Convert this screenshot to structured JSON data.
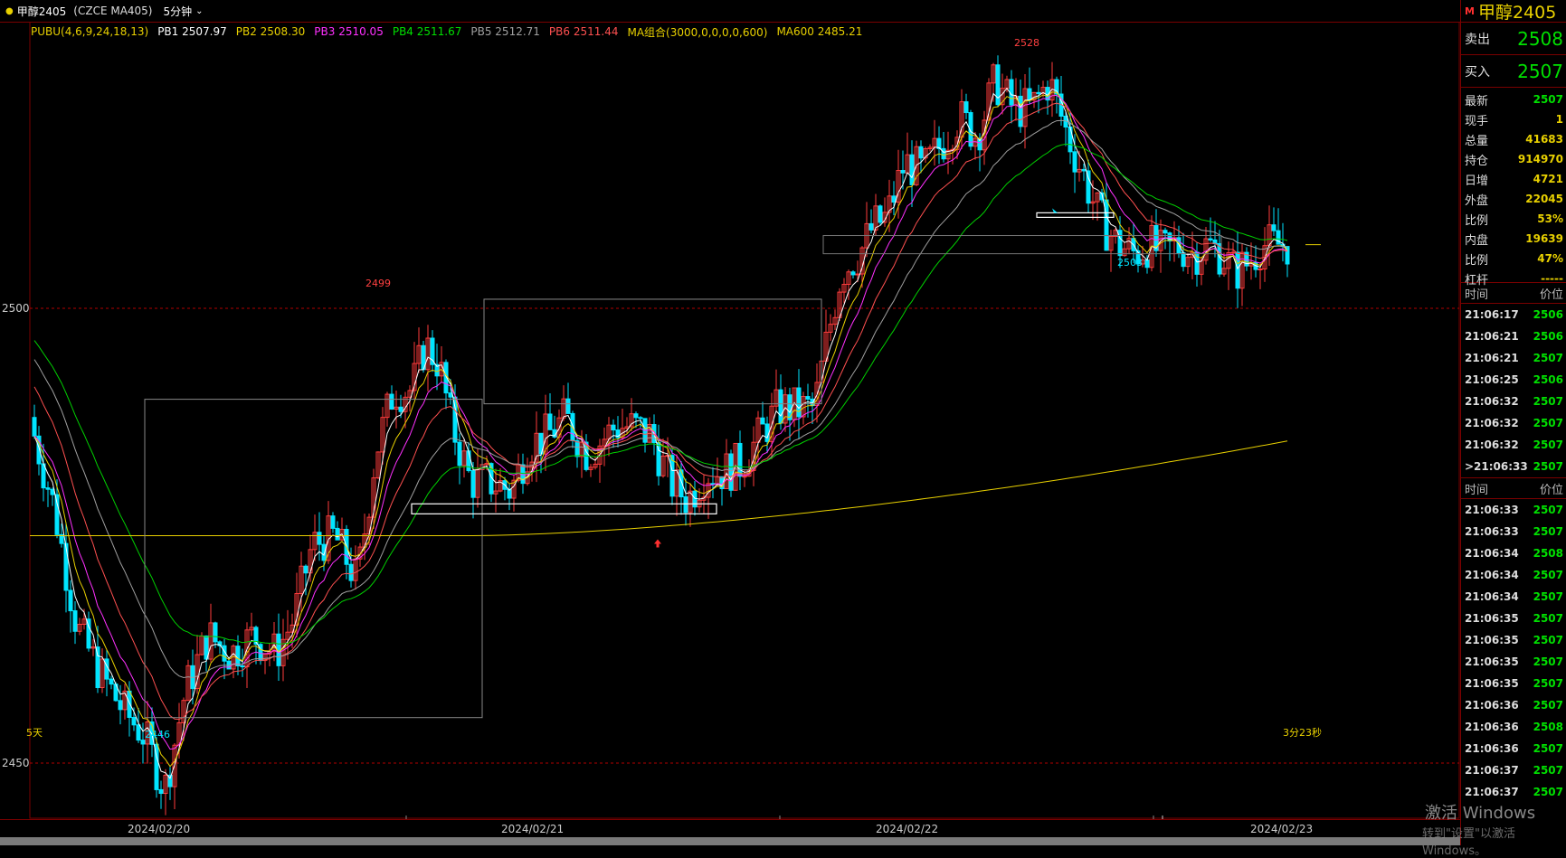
{
  "topbar": {
    "name": "甲醇2405",
    "code": "(CZCE MA405)",
    "period": "5分钟"
  },
  "indicators": [
    {
      "label": "PUBU(4,6,9,24,18,13)",
      "color": "#e8d000"
    },
    {
      "label": "PB1 2507.97",
      "color": "#ffffff"
    },
    {
      "label": "PB2 2508.30",
      "color": "#e8d000"
    },
    {
      "label": "PB3 2510.05",
      "color": "#ff30ff"
    },
    {
      "label": "PB4 2511.67",
      "color": "#00e000"
    },
    {
      "label": "PB5 2512.71",
      "color": "#a0a0a0"
    },
    {
      "label": "PB6 2511.44",
      "color": "#ff5050"
    },
    {
      "label": "MA组合(3000,0,0,0,0,600)",
      "color": "#e8d000"
    },
    {
      "label": "MA600 2485.21",
      "color": "#e8d000"
    }
  ],
  "chart": {
    "price_labels": [
      "2500",
      "2450"
    ],
    "annotations": {
      "high1": "2499",
      "high2": "2528",
      "low1": "2446",
      "low2": "2503"
    },
    "range_label": "5天",
    "bottom_right_label": "3分23秒"
  },
  "chart_data": {
    "type": "candlestick",
    "y_ticks": [
      2450,
      2500
    ],
    "x_labels": [
      "2024/02/20",
      "2024/02/21",
      "2024/02/22",
      "2024/02/23"
    ],
    "keypoints": [
      {
        "label": "2446",
        "value": 2446
      },
      {
        "label": "2499",
        "value": 2499
      },
      {
        "label": "2528",
        "value": 2528
      },
      {
        "label": "2503",
        "value": 2503
      }
    ],
    "ma600_end": 2485.21,
    "last_price": 2507
  },
  "side": {
    "title_mark": "M",
    "title": "甲醇2405",
    "sell_label": "卖出",
    "sell_value": "2508",
    "buy_label": "买入",
    "buy_value": "2507",
    "quote": [
      {
        "label": "最新",
        "value": "2507",
        "color": "#00e000"
      },
      {
        "label": "现手",
        "value": "1",
        "color": "#e8d000"
      },
      {
        "label": "总量",
        "value": "41683",
        "color": "#e8d000"
      },
      {
        "label": "持仓",
        "value": "914970",
        "color": "#e8d000"
      },
      {
        "label": "日增",
        "value": "4721",
        "color": "#e8d000"
      },
      {
        "label": "外盘",
        "value": "22045",
        "color": "#e8d000"
      },
      {
        "label": "比例",
        "value": "53%",
        "color": "#e8d000"
      },
      {
        "label": "内盘",
        "value": "19639",
        "color": "#e8d000"
      },
      {
        "label": "比例",
        "value": "47%",
        "color": "#e8d000"
      },
      {
        "label": "杠杆",
        "value": "-----",
        "color": "#e8d000"
      }
    ],
    "tick_header_time": "时间",
    "tick_header_price": "价位",
    "ticks1": [
      {
        "time": "21:06:17",
        "price": "2506"
      },
      {
        "time": "21:06:21",
        "price": "2506"
      },
      {
        "time": "21:06:21",
        "price": "2507"
      },
      {
        "time": "21:06:25",
        "price": "2506"
      },
      {
        "time": "21:06:32",
        "price": "2507"
      },
      {
        "time": "21:06:32",
        "price": "2507"
      },
      {
        "time": "21:06:32",
        "price": "2507"
      },
      {
        "time": ">21:06:33",
        "price": "2507"
      }
    ],
    "ticks2": [
      {
        "time": "21:06:33",
        "price": "2507"
      },
      {
        "time": "21:06:33",
        "price": "2507"
      },
      {
        "time": "21:06:34",
        "price": "2508"
      },
      {
        "time": "21:06:34",
        "price": "2507"
      },
      {
        "time": "21:06:34",
        "price": "2507"
      },
      {
        "time": "21:06:35",
        "price": "2507"
      },
      {
        "time": "21:06:35",
        "price": "2507"
      },
      {
        "time": "21:06:35",
        "price": "2507"
      },
      {
        "time": "21:06:35",
        "price": "2507"
      },
      {
        "time": "21:06:36",
        "price": "2507"
      },
      {
        "time": "21:06:36",
        "price": "2508"
      },
      {
        "time": "21:06:36",
        "price": "2507"
      },
      {
        "time": "21:06:37",
        "price": "2507"
      },
      {
        "time": "21:06:37",
        "price": "2507"
      }
    ]
  },
  "watermark": {
    "line1": "激活 Windows",
    "line2": "转到\"设置\"以激活 Windows。"
  }
}
